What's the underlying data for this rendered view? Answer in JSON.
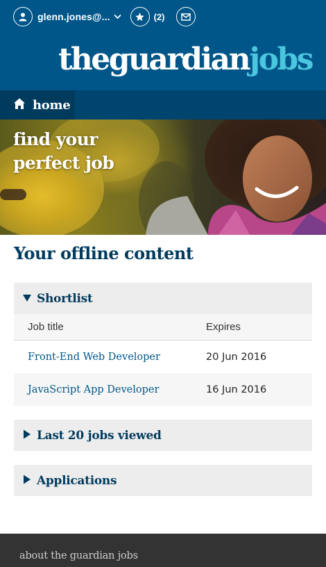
{
  "header": {
    "user_name": "glenn.jones@...",
    "shortlist_count": "(2)",
    "logo_part1": "theguardian",
    "logo_part2": "jobs",
    "icons": [
      "user-icon",
      "chevron-down-icon",
      "star-icon",
      "envelope-icon"
    ]
  },
  "nav": {
    "home_label": "home",
    "icon": "home-icon"
  },
  "hero": {
    "line1": "find your",
    "line2": "perfect job"
  },
  "main": {
    "title": "Your offline content",
    "sections": [
      {
        "label": "Shortlist",
        "expanded": true,
        "columns": [
          "Job title",
          "Expires"
        ],
        "rows": [
          {
            "title": "Front-End Web Developer",
            "expires": "20 Jun 2016"
          },
          {
            "title": "JavaScript App Developer",
            "expires": "16 Jun 2016"
          }
        ]
      },
      {
        "label": "Last 20 jobs viewed",
        "expanded": false
      },
      {
        "label": "Applications",
        "expanded": false
      }
    ]
  },
  "footer": {
    "link": "about the guardian jobs"
  },
  "colors": {
    "brand_blue": "#005689",
    "nav_blue": "#00456e",
    "dark_blue": "#003b5e",
    "jobs_accent": "#4bc6df",
    "section_bg": "#ededed",
    "footer_bg": "#333333"
  }
}
